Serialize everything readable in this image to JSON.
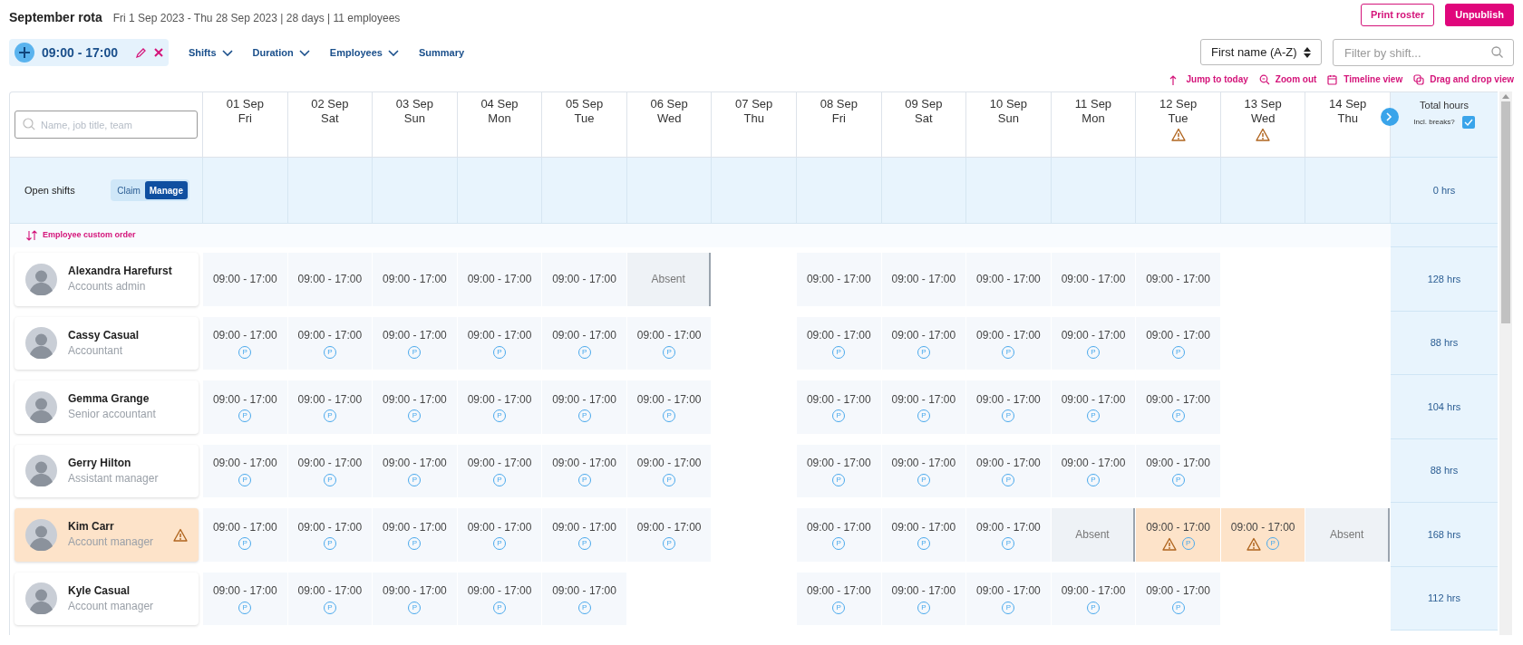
{
  "header": {
    "title": "September rota",
    "subtitle": "Fri 1 Sep 2023 - Thu 28 Sep 2023 | 28 days | 11 employees",
    "buttons": [
      {
        "label": "Print roster",
        "kind": "outline"
      },
      {
        "label": "Unpublish",
        "kind": "primary"
      }
    ]
  },
  "toolbar": {
    "shift_chip": "09:00 - 17:00",
    "menus": [
      {
        "label": "Shifts",
        "dropdown": true
      },
      {
        "label": "Duration",
        "dropdown": true
      },
      {
        "label": "Employees",
        "dropdown": true
      },
      {
        "label": "Summary",
        "dropdown": false
      }
    ],
    "sort": "First name (A-Z)",
    "filter": {
      "placeholder": "Filter by shift..."
    },
    "links": [
      "Jump to today",
      "Zoom out",
      "Timeline view",
      "Drag and drop view"
    ]
  },
  "grid": {
    "search": {
      "placeholder": "Name, job title, team"
    },
    "days": [
      {
        "date": "01 Sep",
        "weekday": "Fri",
        "warning": false
      },
      {
        "date": "02 Sep",
        "weekday": "Sat",
        "warning": false
      },
      {
        "date": "03 Sep",
        "weekday": "Sun",
        "warning": false
      },
      {
        "date": "04 Sep",
        "weekday": "Mon",
        "warning": false
      },
      {
        "date": "05 Sep",
        "weekday": "Tue",
        "warning": false
      },
      {
        "date": "06 Sep",
        "weekday": "Wed",
        "warning": false
      },
      {
        "date": "07 Sep",
        "weekday": "Thu",
        "warning": false
      },
      {
        "date": "08 Sep",
        "weekday": "Fri",
        "warning": false
      },
      {
        "date": "09 Sep",
        "weekday": "Sat",
        "warning": false
      },
      {
        "date": "10 Sep",
        "weekday": "Sun",
        "warning": false
      },
      {
        "date": "11 Sep",
        "weekday": "Mon",
        "warning": false
      },
      {
        "date": "12 Sep",
        "weekday": "Tue",
        "warning": true
      },
      {
        "date": "13 Sep",
        "weekday": "Wed",
        "warning": true
      },
      {
        "date": "14 Sep",
        "weekday": "Thu",
        "warning": false
      }
    ],
    "total_header": {
      "title": "Total hours",
      "breaks_label": "Incl. breaks?",
      "breaks_checked": true
    },
    "open_shifts": {
      "label": "Open shifts",
      "modes": [
        {
          "label": "Claim",
          "selected": false
        },
        {
          "label": "Manage",
          "selected": true
        }
      ],
      "total": "0 hrs"
    },
    "order_label": "Employee custom order",
    "employees": [
      {
        "name": "Alexandra Harefurst",
        "role": "Accounts admin",
        "warning": false,
        "total": "128 hrs",
        "cells": [
          {
            "kind": "shift",
            "time": "09:00 - 17:00",
            "warning": false
          },
          {
            "kind": "shift",
            "time": "09:00 - 17:00",
            "warning": false
          },
          {
            "kind": "shift",
            "time": "09:00 - 17:00",
            "warning": false
          },
          {
            "kind": "shift",
            "time": "09:00 - 17:00",
            "warning": false
          },
          {
            "kind": "shift",
            "time": "09:00 - 17:00",
            "warning": false
          },
          {
            "kind": "absent",
            "text": "Absent"
          },
          {
            "kind": "empty"
          },
          {
            "kind": "shift",
            "time": "09:00 - 17:00",
            "warning": false
          },
          {
            "kind": "shift",
            "time": "09:00 - 17:00",
            "warning": false
          },
          {
            "kind": "shift",
            "time": "09:00 - 17:00",
            "warning": false
          },
          {
            "kind": "shift",
            "time": "09:00 - 17:00",
            "warning": false
          },
          {
            "kind": "shift",
            "time": "09:00 - 17:00",
            "warning": false
          },
          {
            "kind": "empty"
          },
          {
            "kind": "empty"
          }
        ]
      },
      {
        "name": "Cassy Casual",
        "role": "Accountant",
        "warning": false,
        "total": "88 hrs",
        "cells": [
          {
            "kind": "shift",
            "time": "09:00 - 17:00",
            "badge": "P",
            "warning": false
          },
          {
            "kind": "shift",
            "time": "09:00 - 17:00",
            "badge": "P",
            "warning": false
          },
          {
            "kind": "shift",
            "time": "09:00 - 17:00",
            "badge": "P",
            "warning": false
          },
          {
            "kind": "shift",
            "time": "09:00 - 17:00",
            "badge": "P",
            "warning": false
          },
          {
            "kind": "shift",
            "time": "09:00 - 17:00",
            "badge": "P",
            "warning": false
          },
          {
            "kind": "shift",
            "time": "09:00 - 17:00",
            "badge": "P",
            "warning": false
          },
          {
            "kind": "empty"
          },
          {
            "kind": "shift",
            "time": "09:00 - 17:00",
            "badge": "P",
            "warning": false
          },
          {
            "kind": "shift",
            "time": "09:00 - 17:00",
            "badge": "P",
            "warning": false
          },
          {
            "kind": "shift",
            "time": "09:00 - 17:00",
            "badge": "P",
            "warning": false
          },
          {
            "kind": "shift",
            "time": "09:00 - 17:00",
            "badge": "P",
            "warning": false
          },
          {
            "kind": "shift",
            "time": "09:00 - 17:00",
            "badge": "P",
            "warning": false
          },
          {
            "kind": "empty"
          },
          {
            "kind": "empty"
          }
        ]
      },
      {
        "name": "Gemma Grange",
        "role": "Senior accountant",
        "warning": false,
        "total": "104 hrs",
        "cells": [
          {
            "kind": "shift",
            "time": "09:00 - 17:00",
            "badge": "P",
            "warning": false
          },
          {
            "kind": "shift",
            "time": "09:00 - 17:00",
            "badge": "P",
            "warning": false
          },
          {
            "kind": "shift",
            "time": "09:00 - 17:00",
            "badge": "P",
            "warning": false
          },
          {
            "kind": "shift",
            "time": "09:00 - 17:00",
            "badge": "P",
            "warning": false
          },
          {
            "kind": "shift",
            "time": "09:00 - 17:00",
            "badge": "P",
            "warning": false
          },
          {
            "kind": "shift",
            "time": "09:00 - 17:00",
            "badge": "P",
            "warning": false
          },
          {
            "kind": "empty"
          },
          {
            "kind": "shift",
            "time": "09:00 - 17:00",
            "badge": "P",
            "warning": false
          },
          {
            "kind": "shift",
            "time": "09:00 - 17:00",
            "badge": "P",
            "warning": false
          },
          {
            "kind": "shift",
            "time": "09:00 - 17:00",
            "badge": "P",
            "warning": false
          },
          {
            "kind": "shift",
            "time": "09:00 - 17:00",
            "badge": "P",
            "warning": false
          },
          {
            "kind": "shift",
            "time": "09:00 - 17:00",
            "badge": "P",
            "warning": false
          },
          {
            "kind": "empty"
          },
          {
            "kind": "empty"
          }
        ]
      },
      {
        "name": "Gerry Hilton",
        "role": "Assistant manager",
        "warning": false,
        "total": "88 hrs",
        "cells": [
          {
            "kind": "shift",
            "time": "09:00 - 17:00",
            "badge": "P",
            "warning": false
          },
          {
            "kind": "shift",
            "time": "09:00 - 17:00",
            "badge": "P",
            "warning": false
          },
          {
            "kind": "shift",
            "time": "09:00 - 17:00",
            "badge": "P",
            "warning": false
          },
          {
            "kind": "shift",
            "time": "09:00 - 17:00",
            "badge": "P",
            "warning": false
          },
          {
            "kind": "shift",
            "time": "09:00 - 17:00",
            "badge": "P",
            "warning": false
          },
          {
            "kind": "shift",
            "time": "09:00 - 17:00",
            "badge": "P",
            "warning": false
          },
          {
            "kind": "empty"
          },
          {
            "kind": "shift",
            "time": "09:00 - 17:00",
            "badge": "P",
            "warning": false
          },
          {
            "kind": "shift",
            "time": "09:00 - 17:00",
            "badge": "P",
            "warning": false
          },
          {
            "kind": "shift",
            "time": "09:00 - 17:00",
            "badge": "P",
            "warning": false
          },
          {
            "kind": "shift",
            "time": "09:00 - 17:00",
            "badge": "P",
            "warning": false
          },
          {
            "kind": "shift",
            "time": "09:00 - 17:00",
            "badge": "P",
            "warning": false
          },
          {
            "kind": "empty"
          },
          {
            "kind": "empty"
          }
        ]
      },
      {
        "name": "Kim Carr",
        "role": "Account manager",
        "warning": true,
        "total": "168 hrs",
        "cells": [
          {
            "kind": "shift",
            "time": "09:00 - 17:00",
            "badge": "P",
            "warning": false
          },
          {
            "kind": "shift",
            "time": "09:00 - 17:00",
            "badge": "P",
            "warning": false
          },
          {
            "kind": "shift",
            "time": "09:00 - 17:00",
            "badge": "P",
            "warning": false
          },
          {
            "kind": "shift",
            "time": "09:00 - 17:00",
            "badge": "P",
            "warning": false
          },
          {
            "kind": "shift",
            "time": "09:00 - 17:00",
            "badge": "P",
            "warning": false
          },
          {
            "kind": "shift",
            "time": "09:00 - 17:00",
            "badge": "P",
            "warning": false
          },
          {
            "kind": "empty"
          },
          {
            "kind": "shift",
            "time": "09:00 - 17:00",
            "badge": "P",
            "warning": false
          },
          {
            "kind": "shift",
            "time": "09:00 - 17:00",
            "badge": "P",
            "warning": false
          },
          {
            "kind": "shift",
            "time": "09:00 - 17:00",
            "badge": "P",
            "warning": false
          },
          {
            "kind": "absent",
            "text": "Absent"
          },
          {
            "kind": "shift",
            "time": "09:00 - 17:00",
            "badge": "P",
            "warning": true
          },
          {
            "kind": "shift",
            "time": "09:00 - 17:00",
            "badge": "P",
            "warning": true
          },
          {
            "kind": "absent",
            "text": "Absent"
          }
        ]
      },
      {
        "name": "Kyle Casual",
        "role": "Account manager",
        "warning": false,
        "total": "112 hrs",
        "cells": [
          {
            "kind": "shift",
            "time": "09:00 - 17:00",
            "badge": "P",
            "warning": false
          },
          {
            "kind": "shift",
            "time": "09:00 - 17:00",
            "badge": "P",
            "warning": false
          },
          {
            "kind": "shift",
            "time": "09:00 - 17:00",
            "badge": "P",
            "warning": false
          },
          {
            "kind": "shift",
            "time": "09:00 - 17:00",
            "badge": "P",
            "warning": false
          },
          {
            "kind": "shift",
            "time": "09:00 - 17:00",
            "badge": "P",
            "warning": false
          },
          {
            "kind": "empty"
          },
          {
            "kind": "empty"
          },
          {
            "kind": "shift",
            "time": "09:00 - 17:00",
            "badge": "P",
            "warning": false
          },
          {
            "kind": "shift",
            "time": "09:00 - 17:00",
            "badge": "P",
            "warning": false
          },
          {
            "kind": "shift",
            "time": "09:00 - 17:00",
            "badge": "P",
            "warning": false
          },
          {
            "kind": "shift",
            "time": "09:00 - 17:00",
            "badge": "P",
            "warning": false
          },
          {
            "kind": "shift",
            "time": "09:00 - 17:00",
            "badge": "P",
            "warning": false
          },
          {
            "kind": "empty"
          },
          {
            "kind": "empty"
          }
        ]
      }
    ]
  }
}
